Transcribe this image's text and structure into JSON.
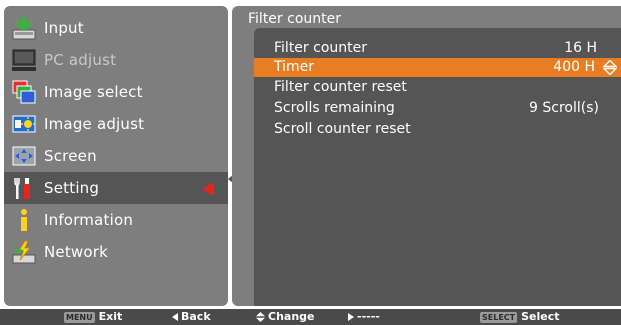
{
  "sidebar": {
    "items": [
      {
        "label": "Input",
        "icon": "input-icon",
        "state": "normal"
      },
      {
        "label": "PC adjust",
        "icon": "pc-adjust-icon",
        "state": "disabled"
      },
      {
        "label": "Image select",
        "icon": "image-select-icon",
        "state": "normal"
      },
      {
        "label": "Image adjust",
        "icon": "image-adjust-icon",
        "state": "normal"
      },
      {
        "label": "Screen",
        "icon": "screen-icon",
        "state": "normal"
      },
      {
        "label": "Setting",
        "icon": "setting-icon",
        "state": "selected"
      },
      {
        "label": "Information",
        "icon": "information-icon",
        "state": "normal"
      },
      {
        "label": "Network",
        "icon": "network-icon",
        "state": "normal"
      }
    ]
  },
  "submenu": {
    "title": "Filter counter",
    "rows": [
      {
        "label": "Filter counter",
        "value": "16 H"
      },
      {
        "label": "Timer",
        "value": "400 H"
      },
      {
        "label": "Filter counter reset",
        "value": ""
      },
      {
        "label": "Scrolls remaining",
        "value": "9  Scroll(s)"
      },
      {
        "label": "Scroll counter reset",
        "value": ""
      }
    ]
  },
  "footer": {
    "exit_key": "MENU",
    "exit_label": "Exit",
    "back_label": "Back",
    "change_label": "Change",
    "next_label": "-----",
    "select_key": "SELECT",
    "select_label": "Select"
  },
  "colors": {
    "panel": "#7e7e7e",
    "selected_bg": "#555555",
    "highlight": "#e87d21",
    "arrow": "#e8241c",
    "footer_bg": "#4a4a4a"
  }
}
